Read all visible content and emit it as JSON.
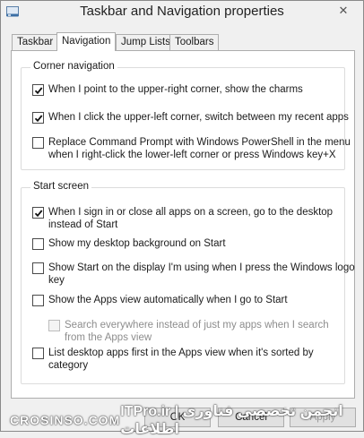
{
  "window": {
    "title": "Taskbar and Navigation properties",
    "close_glyph": "✕"
  },
  "tabs": [
    {
      "label": "Taskbar",
      "active": false
    },
    {
      "label": "Navigation",
      "active": true
    },
    {
      "label": "Jump Lists",
      "active": false
    },
    {
      "label": "Toolbars",
      "active": false
    }
  ],
  "corner_navigation": {
    "title": "Corner navigation",
    "options": [
      {
        "label": "When I point to the upper-right corner, show the charms",
        "checked": true
      },
      {
        "label": "When I click the upper-left corner, switch between my recent apps",
        "checked": true
      },
      {
        "label_lines": [
          "Replace Command Prompt with Windows PowerShell in the menu",
          "when I right-click the lower-left corner or press Windows key+X"
        ],
        "checked": false
      }
    ]
  },
  "start_screen": {
    "title": "Start screen",
    "options": [
      {
        "label_lines": [
          "When I sign in or close all apps on a screen, go to the desktop",
          "instead of Start"
        ],
        "checked": true
      },
      {
        "label": "Show my desktop background on Start",
        "checked": false
      },
      {
        "label_lines": [
          "Show Start on the display I'm using when I press the Windows logo",
          "key"
        ],
        "checked": false
      },
      {
        "label": "Show the Apps view automatically when I go to Start",
        "checked": false
      },
      {
        "label_lines": [
          "Search everywhere instead of just my apps when I search",
          "from the Apps view"
        ],
        "checked": false,
        "disabled": true
      },
      {
        "label_lines": [
          "List desktop apps first in the Apps view when it's sorted by",
          "category"
        ],
        "checked": false
      }
    ]
  },
  "buttons": {
    "ok": "OK",
    "cancel": "Cancel",
    "apply": "Apply"
  },
  "watermark": {
    "left": "CROSINSO.COM",
    "right": "ITPro.ir | انجمن تخصصی فناوری اطلاعات"
  }
}
